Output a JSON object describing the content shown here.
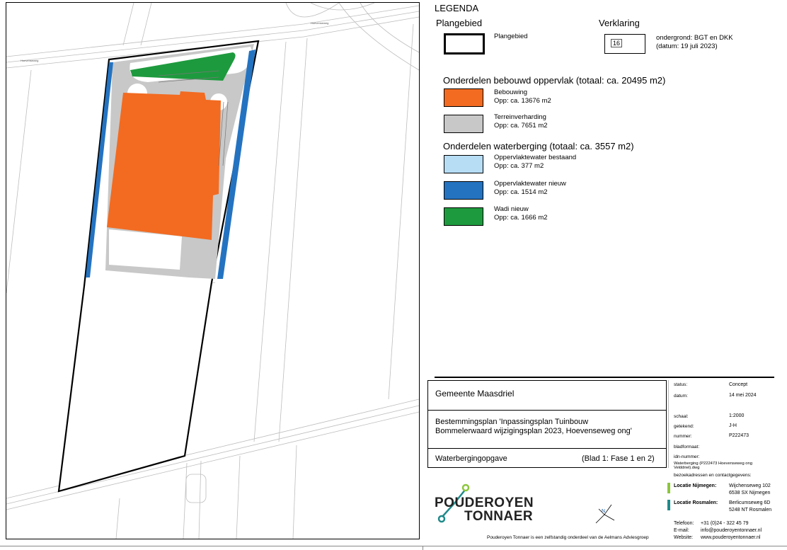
{
  "legend": {
    "title": "LEGENDA",
    "plangebied_heading": "Plangebied",
    "plangebied_label": "Plangebied",
    "verklaring_heading": "Verklaring",
    "verklaring_number": "16",
    "verklaring_line1": "ondergrond: BGT en DKK",
    "verklaring_line2": "(datum: 19 juli 2023)",
    "bebouwd_heading": "Onderdelen bebouwd oppervlak (totaal: ca. 20495 m2)",
    "waterberging_heading": "Onderdelen waterberging (totaal: ca. 3557 m2)",
    "items": [
      {
        "name": "Bebouwing",
        "area": "Opp: ca. 13676 m2",
        "color": "#F26B21"
      },
      {
        "name": "Terreinverharding",
        "area": "Opp: ca. 7651 m2",
        "color": "#C8C8C8"
      },
      {
        "name": "Oppervlaktewater bestaand",
        "area": "Opp: ca. 377 m2",
        "color": "#B7DDF5"
      },
      {
        "name": "Oppervlaktewater nieuw",
        "area": "Opp: ca. 1514 m2",
        "color": "#2473C1"
      },
      {
        "name": "Wadi nieuw",
        "area": "Opp: ca. 1666 m2",
        "color": "#1E9A3E"
      }
    ]
  },
  "map": {
    "road_label_left": "Hoevenseweg",
    "road_label_right": "Hoevenseweg"
  },
  "titleblock": {
    "municipality": "Gemeente Maasdriel",
    "plan_line1": "Bestemmingsplan 'Inpassingsplan Tuinbouw",
    "plan_line2": "Bommelerwaard wijzigingsplan 2023, Hoevenseweg ong'",
    "subject": "Waterbergingopgave",
    "sheet": "(Blad 1: Fase 1 en 2)",
    "fields": [
      {
        "label": "status:",
        "value": "Concept"
      },
      {
        "label": "datum:",
        "value": "14 mei 2024"
      },
      {
        "label": "schaal:",
        "value": "1:2000"
      },
      {
        "label": "getekend:",
        "value": "J-H"
      },
      {
        "label": "nummer:",
        "value": "P222473"
      },
      {
        "label": "bladformaat:",
        "value": ""
      },
      {
        "label": "idn-nummer:",
        "value": ""
      }
    ],
    "filename": "Waterberging (P222473 Hoevenseweg ong Velddriel).dwg",
    "contact_heading": "bezoekadressen en contactgegevens:",
    "loc1_name": "Locatie Nijmegen:",
    "loc1_addr1": "Wijchenseweg 102",
    "loc1_addr2": "6538 SX Nijmegen",
    "loc2_name": "Locatie Rosmalen:",
    "loc2_addr1": "Berlicumseweg 6D",
    "loc2_addr2": "5248 NT Rosmalen",
    "tel_label": "Telefoon:",
    "tel": "+31 (0)24 - 322 45 79",
    "email_label": "E-mail:",
    "email": "info@pouderoyentonnaer.nl",
    "web_label": "Website:",
    "web": "www.pouderoyentonnaer.nl",
    "logo_line1": "POUDEROYEN",
    "logo_line2": "TONNAER",
    "footer": "Pouderoyen Tonnaer is een zelfstandig onderdeel van de Aelmans Adviesgroep",
    "north": "N",
    "accent1": "#8DC63F",
    "accent2": "#1F8A8A"
  }
}
